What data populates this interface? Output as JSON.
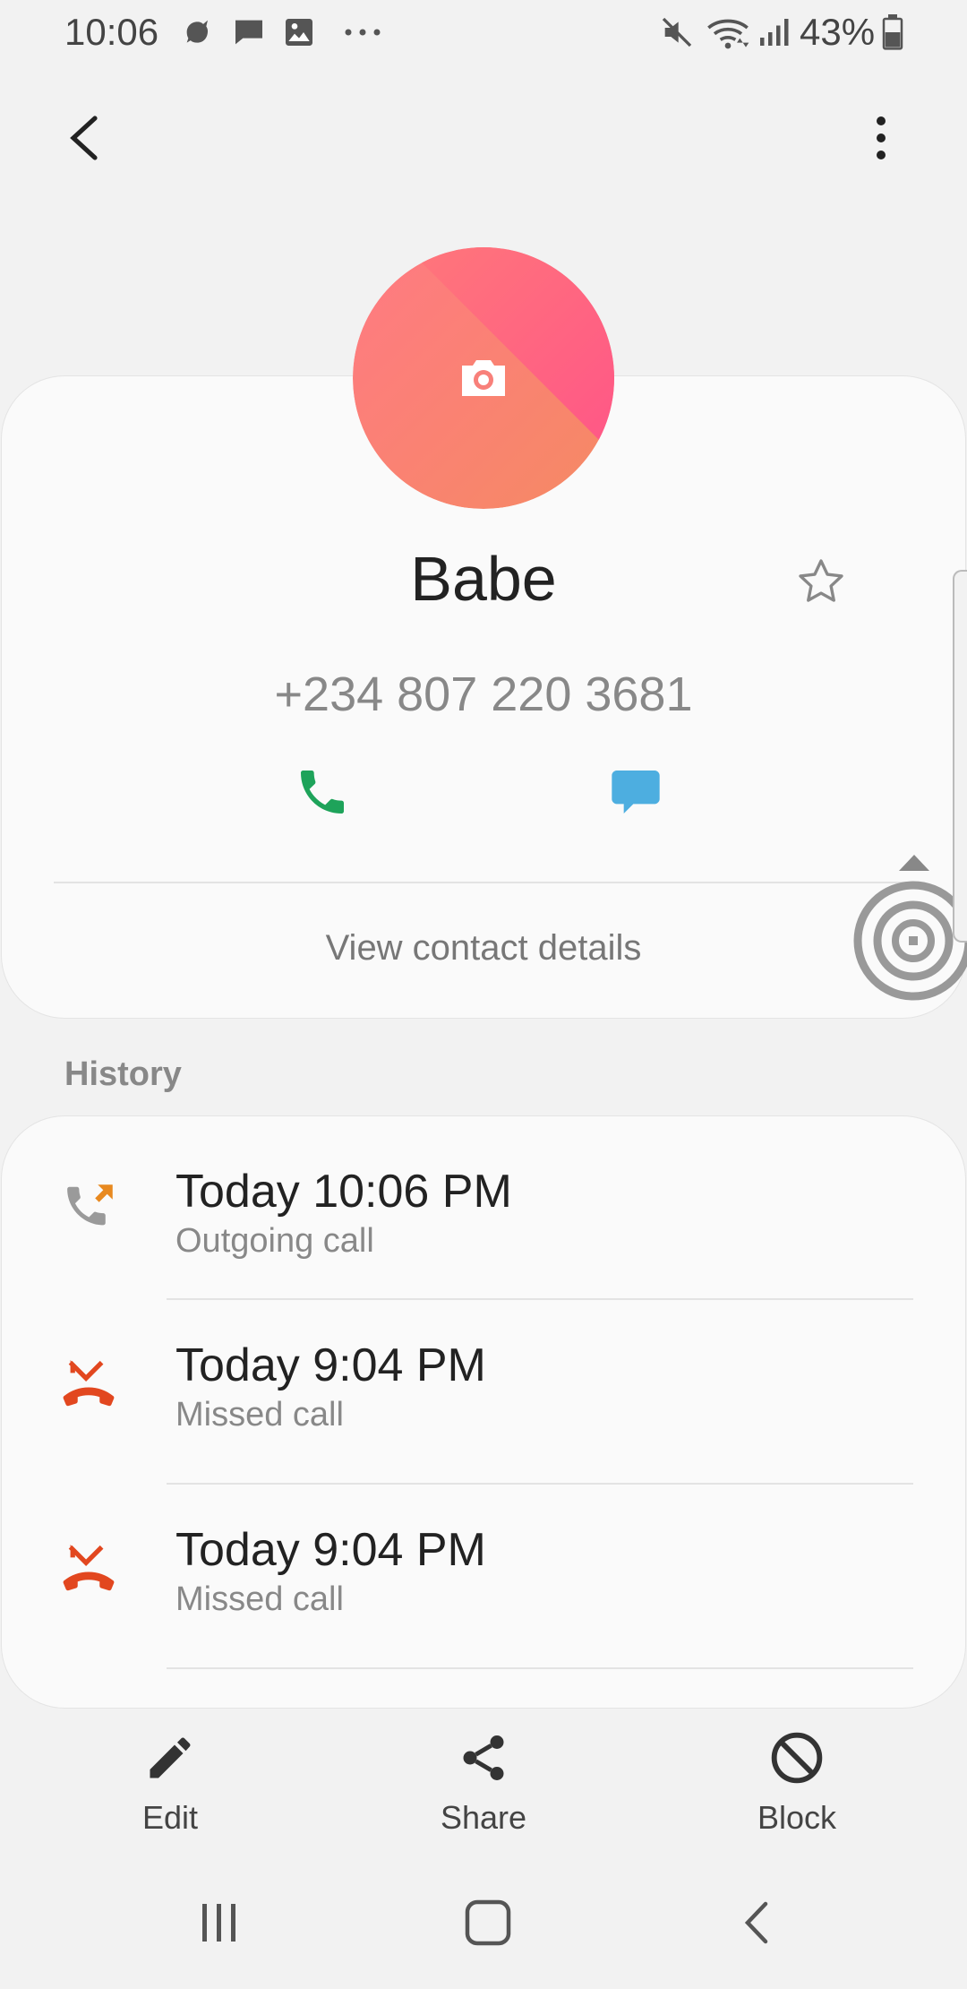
{
  "status_bar": {
    "time": "10:06",
    "battery": "43%"
  },
  "contact": {
    "name": "Babe",
    "phone": "+234 807 220 3681",
    "view_details": "View contact details",
    "avatar_colors": [
      "#ff7c86",
      "#ff5a8a",
      "#f39058"
    ]
  },
  "history": {
    "title": "History",
    "items": [
      {
        "time": "Today 10:06 PM",
        "type": "Outgoing call",
        "icon": "outgoing-call-icon"
      },
      {
        "time": "Today 9:04 PM",
        "type": "Missed call",
        "icon": "missed-call-icon"
      },
      {
        "time": "Today 9:04 PM",
        "type": "Missed call",
        "icon": "missed-call-icon"
      }
    ]
  },
  "actions": {
    "edit": "Edit",
    "share": "Share",
    "block": "Block"
  },
  "colors": {
    "call_green": "#1ea35a",
    "message_blue": "#4daee0",
    "missed_red": "#e2471f",
    "outgoing_orange": "#e8891f"
  }
}
